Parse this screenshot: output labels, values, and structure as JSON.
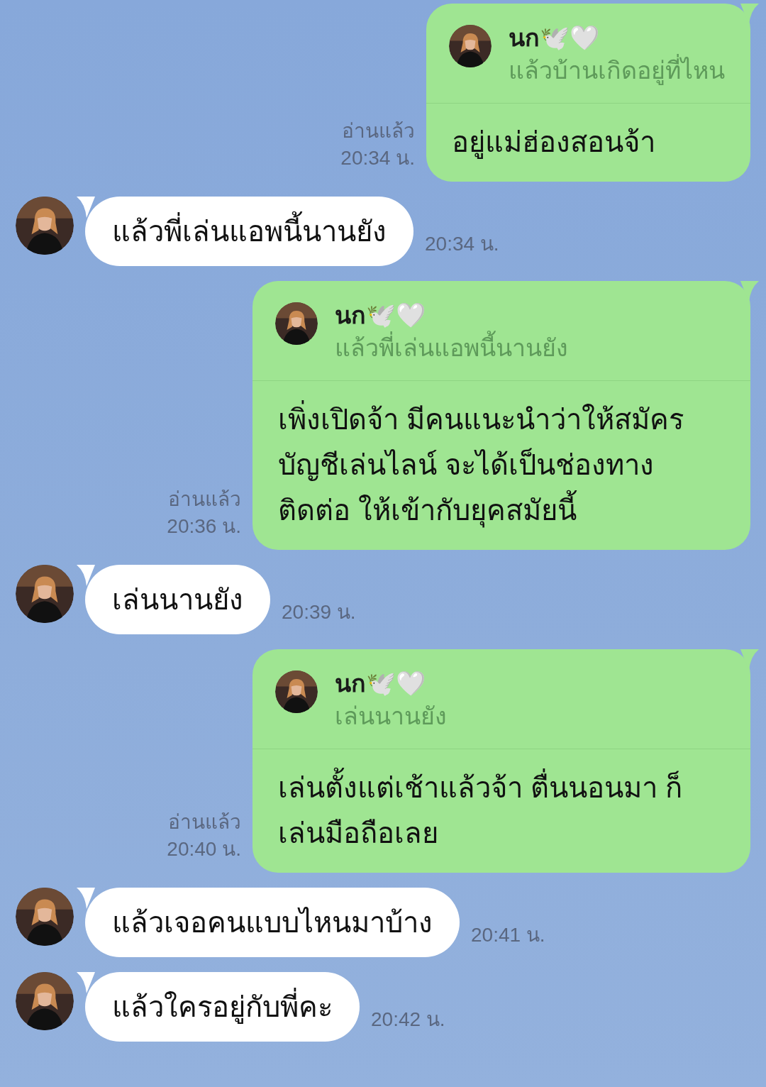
{
  "messages": [
    {
      "kind": "outgoing",
      "reply": {
        "name": "นก🕊️🤍",
        "text": "แล้วบ้านเกิดอยู่ที่ไหน"
      },
      "text": "อยู่แม่ฮ่องสอนจ้า",
      "read": "อ่านแล้ว",
      "time": "20:34 น."
    },
    {
      "kind": "incoming",
      "text": "แล้วพี่เล่นแอพนี้นานยัง",
      "time": "20:34 น."
    },
    {
      "kind": "outgoing",
      "reply": {
        "name": "นก🕊️🤍",
        "text": "แล้วพี่เล่นแอพนี้นานยัง"
      },
      "text": "เพิ่งเปิดจ้า มีคนแนะนำว่าให้สมัคร บัญชีเล่นไลน์ จะได้เป็นช่องทางติดต่อ ให้เข้ากับยุคสมัยนี้",
      "read": "อ่านแล้ว",
      "time": "20:36 น."
    },
    {
      "kind": "incoming",
      "text": "เล่นนานยัง",
      "time": "20:39 น."
    },
    {
      "kind": "outgoing",
      "reply": {
        "name": "นก🕊️🤍",
        "text": "เล่นนานยัง"
      },
      "text": "เล่นตั้งแต่เช้าแล้วจ้า ตื่นนอนมา ก็เล่นมือถือเลย",
      "read": "อ่านแล้ว",
      "time": "20:40 น."
    },
    {
      "kind": "incoming",
      "text": "แล้วเจอคนแบบไหนมาบ้าง",
      "time": "20:41 น."
    },
    {
      "kind": "incoming",
      "text": "แล้วใครอยู่กับพี่คะ",
      "time": "20:42 น."
    }
  ]
}
